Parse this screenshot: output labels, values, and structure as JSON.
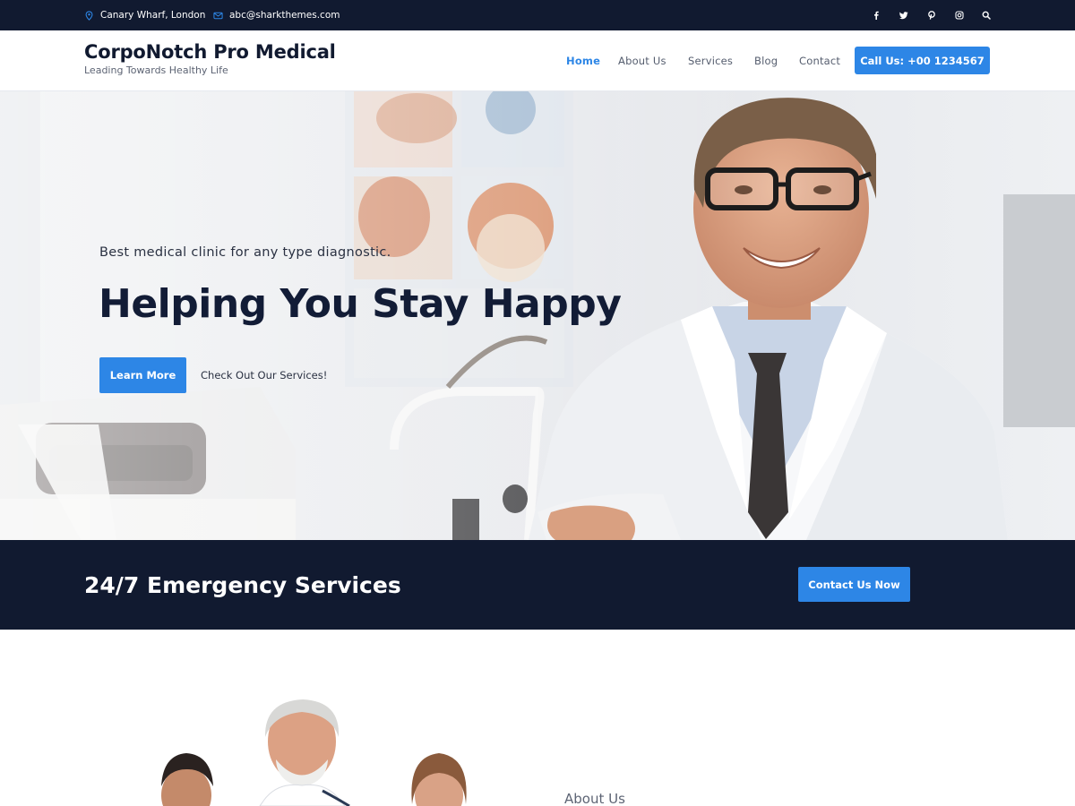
{
  "topbar": {
    "location": "Canary Wharf, London",
    "email": "abc@sharkthemes.com",
    "socials": [
      "facebook-icon",
      "twitter-icon",
      "pinterest-icon",
      "instagram-icon",
      "search-icon"
    ]
  },
  "header": {
    "brand_title": "CorpoNotch Pro Medical",
    "brand_tagline": "Leading Towards Healthy Life",
    "nav": {
      "home": "Home",
      "about": "About Us",
      "services": "Services",
      "blog": "Blog",
      "contact": "Contact"
    },
    "call_button": "Call Us: +00 1234567"
  },
  "hero": {
    "subtitle": "Best medical clinic for any type diagnostic.",
    "title": "Helping You Stay Happy",
    "learn_more": "Learn More",
    "check_services": "Check Out Our Services!"
  },
  "emergency": {
    "title": "24/7 Emergency Services",
    "button": "Contact Us Now"
  },
  "about": {
    "label": "About Us"
  },
  "colors": {
    "navy": "#111a30",
    "accent": "#2d86e6",
    "text_muted": "#5d6474"
  }
}
